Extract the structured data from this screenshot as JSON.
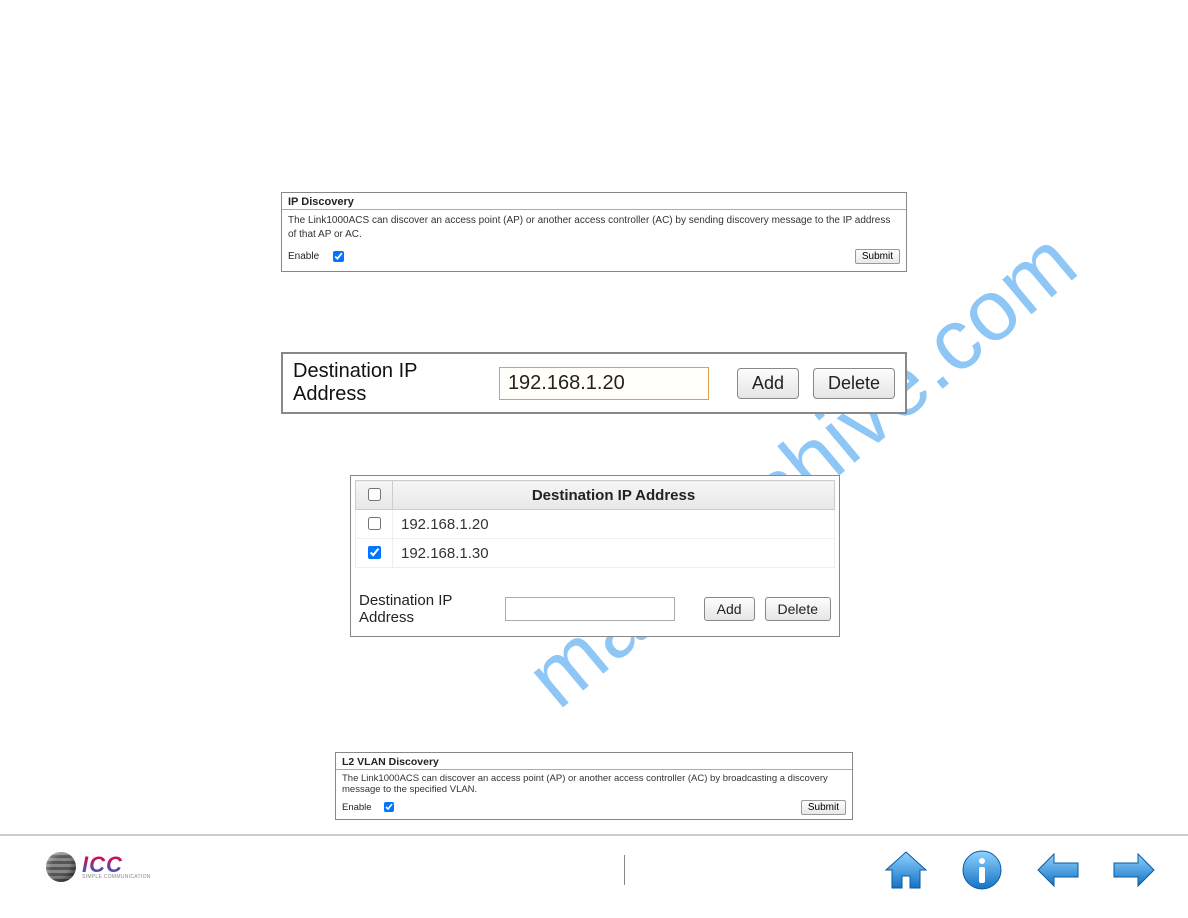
{
  "watermark": "manualshive.com",
  "ip_discovery": {
    "title": "IP Discovery",
    "desc": "The Link1000ACS can discover an access point (AP) or another access controller (AC) by sending discovery message to the IP address of that AP or AC.",
    "enable_label": "Enable",
    "enable_checked": true,
    "submit_label": "Submit"
  },
  "dest_row": {
    "label": "Destination IP Address",
    "value": "192.168.1.20",
    "add_label": "Add",
    "delete_label": "Delete"
  },
  "dest_table": {
    "header_label": "Destination IP Address",
    "rows": [
      {
        "checked": false,
        "ip": "192.168.1.20"
      },
      {
        "checked": true,
        "ip": "192.168.1.30"
      }
    ],
    "below_label": "Destination IP Address",
    "below_value": "",
    "add_label": "Add",
    "delete_label": "Delete"
  },
  "l2_vlan": {
    "title": "L2 VLAN Discovery",
    "desc": "The Link1000ACS can discover an access point (AP) or another access controller (AC) by broadcasting a discovery message to the specified VLAN.",
    "enable_label": "Enable",
    "enable_checked": true,
    "submit_label": "Submit"
  },
  "logo": {
    "text": "ICC",
    "sub": "SIMPLE COMMUNICATION"
  }
}
